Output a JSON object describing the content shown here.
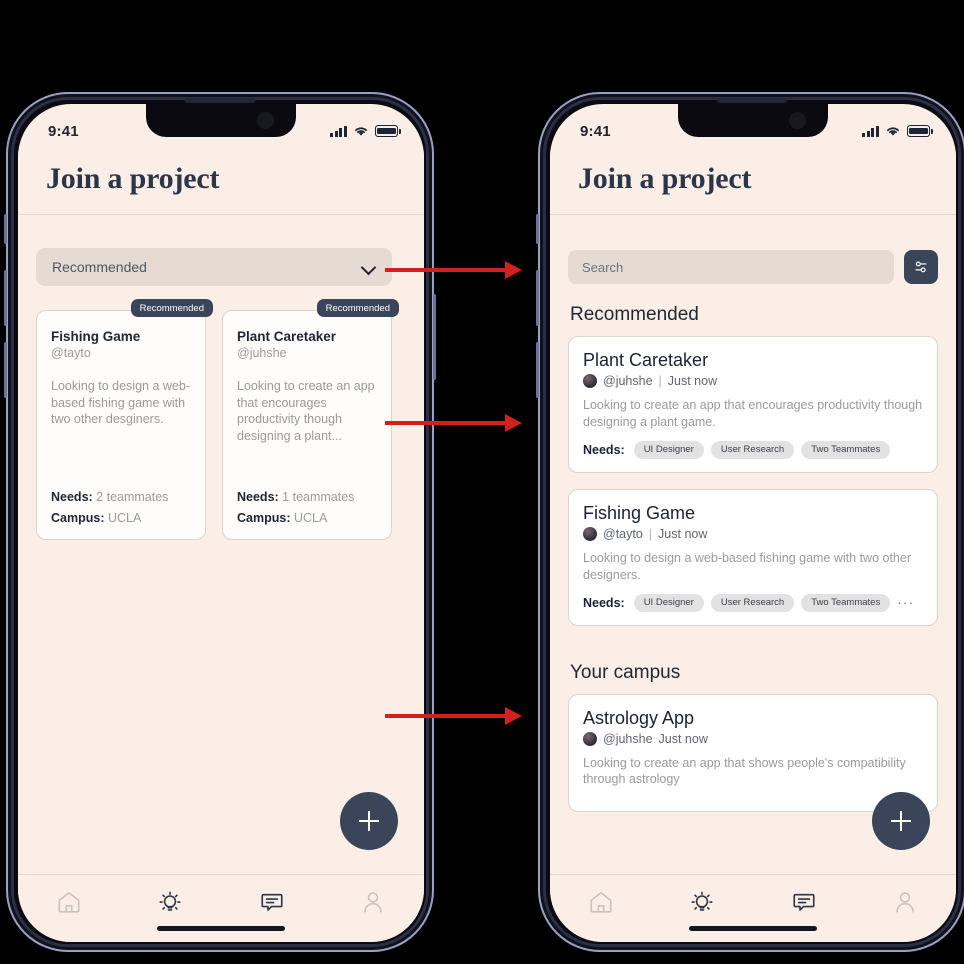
{
  "meta": {
    "background_color": "#000000",
    "screen_bg": "#faeee6",
    "accent_dark": "#3b4559",
    "arrow_color": "#d12020"
  },
  "status_bar": {
    "time": "9:41",
    "signal_icon": "signal-bars-icon",
    "wifi_icon": "wifi-icon",
    "battery_icon": "battery-icon"
  },
  "header": {
    "title": "Join a project"
  },
  "left_screen": {
    "dropdown": {
      "label": "Recommended",
      "chevron_icon": "chevron-down-icon"
    },
    "cards": [
      {
        "badge": "Recommended",
        "title": "Fishing Game",
        "handle": "@tayto",
        "description": "Looking to design a web-based fishing game with two other desginers.",
        "needs_label": "Needs:",
        "needs_value": "2 teammates",
        "campus_label": "Campus:",
        "campus_value": "UCLA"
      },
      {
        "badge": "Recommended",
        "title": "Plant Caretaker",
        "handle": "@juhshe",
        "description": "Looking to create an app that encourages productivity though designing a plant...",
        "needs_label": "Needs:",
        "needs_value": "1 teammates",
        "campus_label": "Campus:",
        "campus_value": "UCLA"
      }
    ]
  },
  "right_screen": {
    "search": {
      "value": "",
      "placeholder": "Search",
      "filter_icon": "filter-sliders-icon"
    },
    "sections": [
      {
        "title": "Recommended",
        "cards": [
          {
            "title": "Plant Caretaker",
            "handle": "@juhshe",
            "separator": "|",
            "time": "Just now",
            "description": "Looking to create an app that encourages productivity though designing a plant game.",
            "needs_label": "Needs:",
            "chips": [
              "UI Designer",
              "User Research",
              "Two Teammates"
            ],
            "overflow": ""
          },
          {
            "title": "Fishing Game",
            "handle": "@tayto",
            "separator": "|",
            "time": "Just now",
            "description": "Looking to design a web-based fishing game with two other designers.",
            "needs_label": "Needs:",
            "chips": [
              "UI Designer",
              "User Research",
              "Two Teammates"
            ],
            "overflow": "···"
          }
        ]
      },
      {
        "title": "Your campus",
        "cards": [
          {
            "title": "Astrology App",
            "handle": "@juhshe",
            "separator": "",
            "time": "Just now",
            "description": "Looking to create an app that shows people's compatibility through astrology",
            "needs_label": "",
            "chips": [],
            "overflow": ""
          }
        ]
      }
    ]
  },
  "fab": {
    "icon": "plus-icon",
    "label": "+"
  },
  "tab_bar": {
    "items": [
      {
        "name": "home",
        "icon": "home-icon",
        "active": false
      },
      {
        "name": "ideas",
        "icon": "lightbulb-icon",
        "active": true
      },
      {
        "name": "messages",
        "icon": "chat-bubble-icon",
        "active": true
      },
      {
        "name": "profile",
        "icon": "person-icon",
        "active": false
      }
    ]
  },
  "annotations": {
    "arrows": [
      {
        "name": "arrow-dropdown-to-search"
      },
      {
        "name": "arrow-cards-to-list"
      },
      {
        "name": "arrow-empty-to-campus"
      }
    ]
  }
}
